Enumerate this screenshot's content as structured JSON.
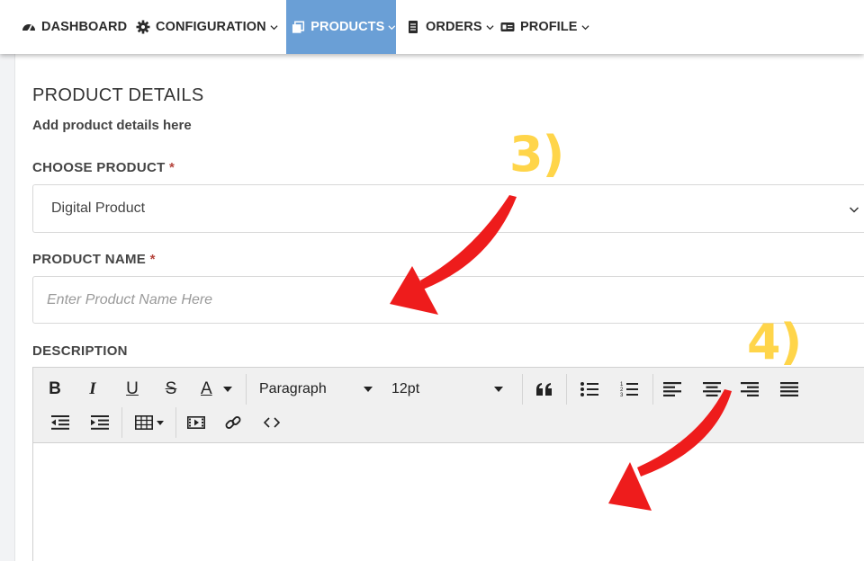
{
  "nav": {
    "items": [
      {
        "label": "DASHBOARD",
        "icon": "dashboard-icon",
        "has_dropdown": false,
        "active": false
      },
      {
        "label": "CONFIGURATION",
        "icon": "gear-icon",
        "has_dropdown": true,
        "active": false
      },
      {
        "label": "PRODUCTS",
        "icon": "products-icon",
        "has_dropdown": true,
        "active": true
      },
      {
        "label": "ORDERS",
        "icon": "orders-icon",
        "has_dropdown": true,
        "active": false
      },
      {
        "label": "PROFILE",
        "icon": "profile-card-icon",
        "has_dropdown": true,
        "active": false
      }
    ],
    "active_color": "#6a9fd6"
  },
  "section": {
    "title": "PRODUCT DETAILS",
    "subtitle": "Add product details here"
  },
  "fields": {
    "choose_product": {
      "label": "CHOOSE PRODUCT",
      "required_mark": "*",
      "value": "Digital Product"
    },
    "product_name": {
      "label": "PRODUCT NAME",
      "required_mark": "*",
      "value": "",
      "placeholder": "Enter Product Name Here"
    },
    "description": {
      "label": "DESCRIPTION"
    }
  },
  "editor": {
    "toolbar": {
      "bold": "B",
      "italic": "I",
      "underline": "U",
      "strikethrough": "S",
      "text_color": "A",
      "block_format": "Paragraph",
      "font_size": "12pt",
      "buttons": [
        "blockquote-icon",
        "bullet-list-icon",
        "numbered-list-icon",
        "align-left-icon",
        "align-center-icon",
        "align-right-icon",
        "align-justify-icon",
        "outdent-icon",
        "indent-icon",
        "table-icon",
        "media-icon",
        "link-icon",
        "code-icon"
      ]
    },
    "content": ""
  },
  "annotations": {
    "step3": "3)",
    "step4": "4)",
    "label_color": "#ffd54a",
    "arrow_color": "#ee1c1c"
  }
}
